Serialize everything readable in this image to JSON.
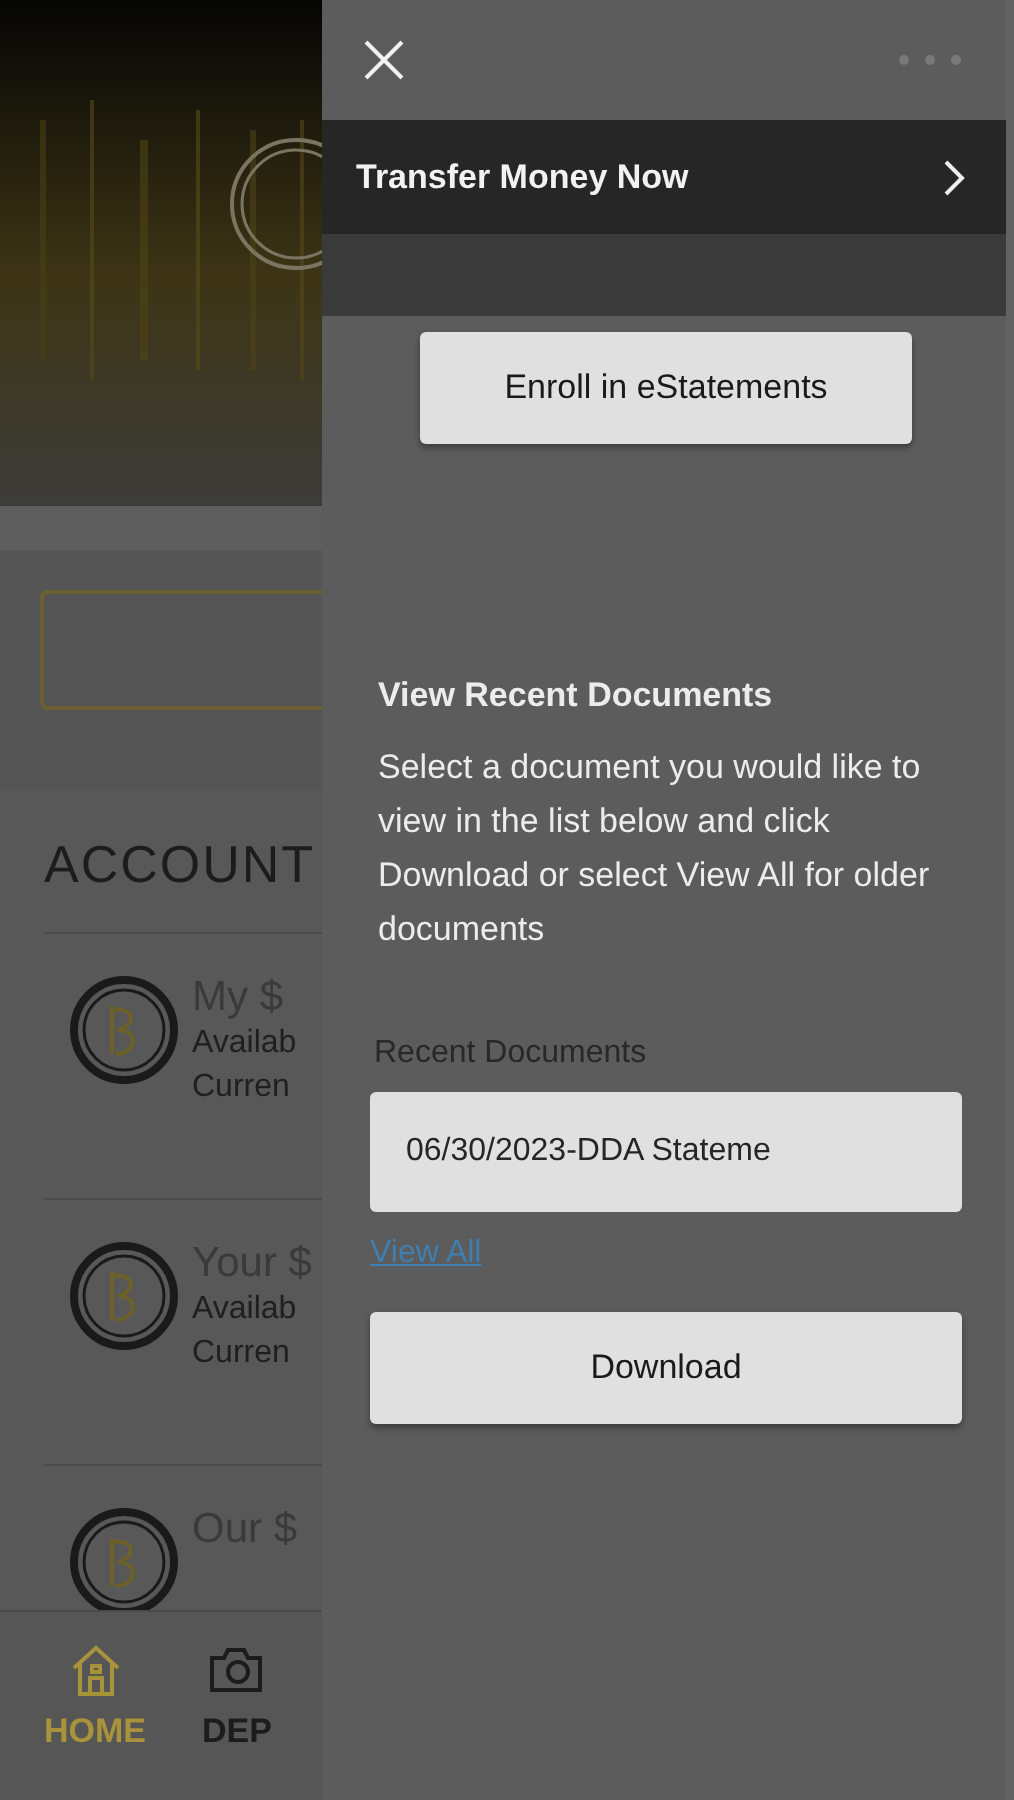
{
  "background": {
    "heading": "ACCOUNT",
    "accounts": [
      {
        "name": "My $",
        "lines": [
          "Availab",
          "Curren"
        ]
      },
      {
        "name": "Your $",
        "lines": [
          "Availab",
          "Curren"
        ]
      },
      {
        "name": "Our $"
      }
    ],
    "nav": {
      "items": [
        {
          "label": "HOME",
          "kind": "home",
          "selected": true
        },
        {
          "label": "DEP",
          "kind": "camera",
          "selected": false
        }
      ]
    }
  },
  "panel": {
    "menu_item": {
      "label": "Transfer Money Now"
    },
    "enroll_button": "Enroll in eStatements",
    "heading": "View Recent Documents",
    "description": "Select a document you would like to view in the list below and click Download or select View All for older documents",
    "documents_label": "Recent Documents",
    "document_select": {
      "value": "06/30/2023-DDA Stateme"
    },
    "view_all_link": "View All",
    "download_button": "Download"
  }
}
